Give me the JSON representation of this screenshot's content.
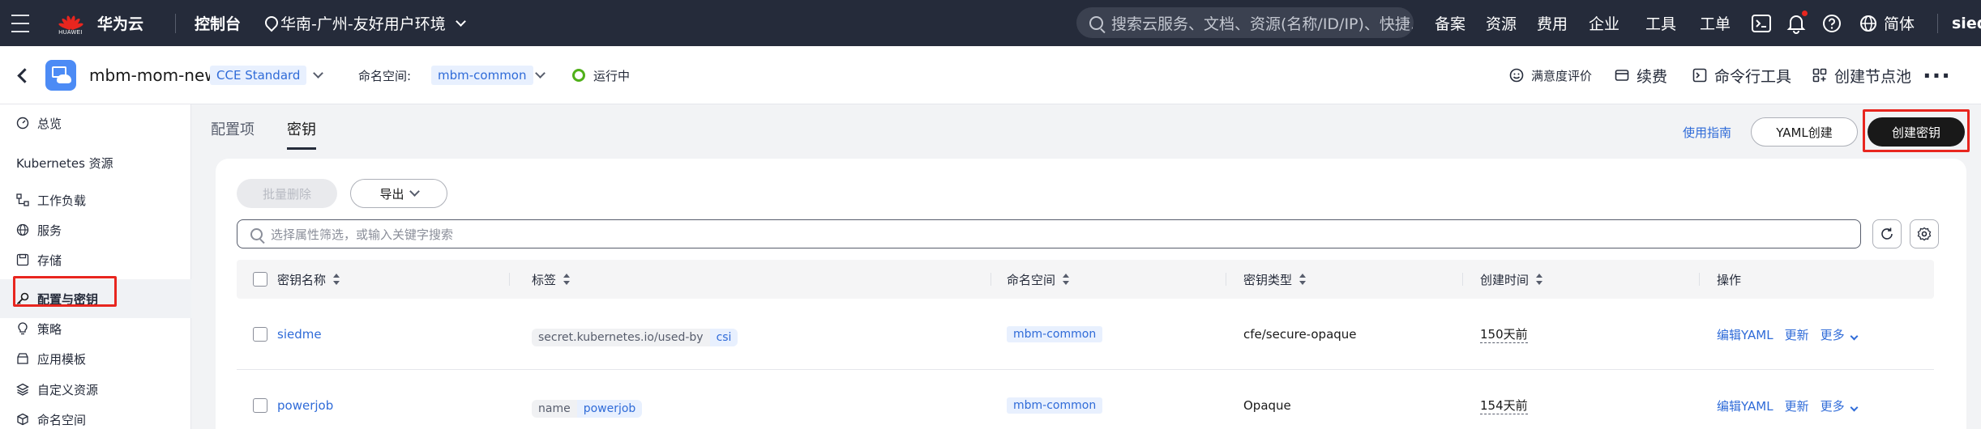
{
  "topbar": {
    "logo_word": "HUAWEI",
    "brand": "华为云",
    "console": "控制台",
    "region": "华南-广州-友好用户环境",
    "search_placeholder": "搜索云服务、文档、资源(名称/ID/IP)、快捷...",
    "links": [
      "备案",
      "资源",
      "费用",
      "企业",
      "工具",
      "工单"
    ],
    "lang": "简体",
    "user_fragment": "sied"
  },
  "subheader": {
    "cluster_name": "mbm-mom-new",
    "version": "CCE Standard",
    "namespace_label": "命名空间:",
    "namespace_value": "mbm-common",
    "status": "运行中",
    "actions": {
      "rating": "满意度评价",
      "renew": "续费",
      "cli": "命令行工具",
      "nodepool": "创建节点池"
    },
    "more": "···"
  },
  "sidebar": {
    "overview": "总览",
    "section_title": "Kubernetes 资源",
    "items": [
      {
        "label": "工作负载",
        "icon": "workload-icon"
      },
      {
        "label": "服务",
        "icon": "globe-icon"
      },
      {
        "label": "存储",
        "icon": "storage-icon"
      },
      {
        "label": "配置与密钥",
        "icon": "key-icon"
      },
      {
        "label": "策略",
        "icon": "bulb-icon"
      },
      {
        "label": "应用模板",
        "icon": "template-icon"
      },
      {
        "label": "自定义资源",
        "icon": "layers-icon"
      },
      {
        "label": "命名空间",
        "icon": "cube-icon"
      }
    ]
  },
  "main": {
    "tabs": [
      "配置项",
      "密钥"
    ],
    "guide_link": "使用指南",
    "yaml_create": "YAML创建",
    "create_secret": "创建密钥",
    "batch_delete": "批量删除",
    "export": "导出",
    "filter_placeholder": "选择属性筛选，或输入关键字搜索",
    "columns": [
      "密钥名称",
      "标签",
      "命名空间",
      "密钥类型",
      "创建时间",
      "操作"
    ],
    "rows": [
      {
        "name": "siedme",
        "label_key": "secret.kubernetes.io/used-by",
        "label_value": "csi",
        "namespace": "mbm-common",
        "type": "cfe/secure-opaque",
        "created": "150天前"
      },
      {
        "name": "powerjob",
        "label_key": "name",
        "label_value": "powerjob",
        "namespace": "mbm-common",
        "type": "Opaque",
        "created": "154天前"
      }
    ],
    "row_actions": {
      "edit": "编辑YAML",
      "update": "更新",
      "more": "更多"
    }
  },
  "colors": {
    "topbar": "#252b3a",
    "link": "#2f6bd8",
    "highlight": "#e8261f",
    "running": "#50b01a"
  }
}
